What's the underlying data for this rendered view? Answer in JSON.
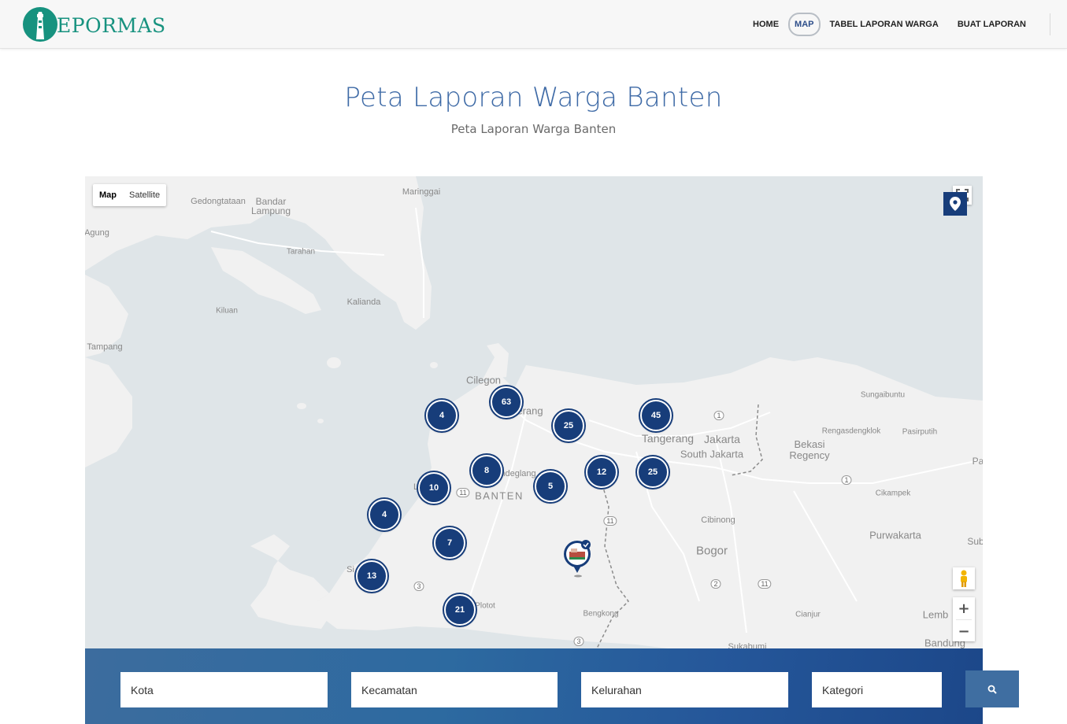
{
  "brand": {
    "name": "EPORMAS"
  },
  "nav": {
    "home": "HOME",
    "map": "MAP",
    "table": "TABEL LAPORAN WARGA",
    "create": "BUAT LAPORAN"
  },
  "page": {
    "title": "Peta Laporan Warga Banten",
    "subtitle": "Peta Laporan Warga Banten"
  },
  "map": {
    "type_map": "Map",
    "type_satellite": "Satellite",
    "places": {
      "gedongtataan": "Gedongtataan",
      "bandar_lampung": "Bandar\nLampung",
      "maringgai": "Maringgai",
      "agung": "Agung",
      "tarahan": "Tarahan",
      "kalianda": "Kalianda",
      "kiluan": "Kiluan",
      "tampang": "Tampang",
      "cilegon": "Cilegon",
      "serang": "erang",
      "pandeglang": "ndeglang",
      "banten": "BANTEN",
      "tangerang": "Tangerang",
      "jakarta": "Jakarta",
      "south_jakarta": "South Jakarta",
      "bekasi": "Bekasi\nRegency",
      "sungaibuntu": "Sungaibuntu",
      "rengasdengklok": "Rengasdengklok",
      "pasirputih": "Pasirputih",
      "cikampek": "Cikampek",
      "purwakarta": "Purwakarta",
      "cibinong": "Cibinong",
      "bogor": "Bogor",
      "cianjur": "Cianjur",
      "sukabumi": "Sukabumi",
      "bandung": "Bandung",
      "lemb": "Lemb",
      "sub": "Sub",
      "pa": "Pa",
      "bengkong": "Bengkong",
      "plotot": "Plotot",
      "si": "Si",
      "l": "L"
    },
    "road_shields": {
      "r1a": "1",
      "r1b": "1",
      "r11a": "11",
      "r11b": "11",
      "r11c": "11",
      "r2": "2",
      "r3a": "3",
      "r3b": "3"
    },
    "clusters": {
      "c63": "63",
      "c4a": "4",
      "c25a": "25",
      "c45": "45",
      "c8": "8",
      "c10": "10",
      "c5": "5",
      "c12": "12",
      "c25b": "25",
      "c4b": "4",
      "c7": "7",
      "c13": "13",
      "c21": "21"
    }
  },
  "filters": {
    "kota": "Kota",
    "kecamatan": "Kecamatan",
    "kelurahan": "Kelurahan",
    "kategori": "Kategori"
  },
  "icons": {
    "locate": "map-pin-icon",
    "search": "search-icon",
    "fullscreen": "fullscreen-icon",
    "pegman": "street-view-icon"
  },
  "colors": {
    "brand": "#17927f",
    "accent": "#173d7a",
    "title": "#3e6aa6"
  }
}
